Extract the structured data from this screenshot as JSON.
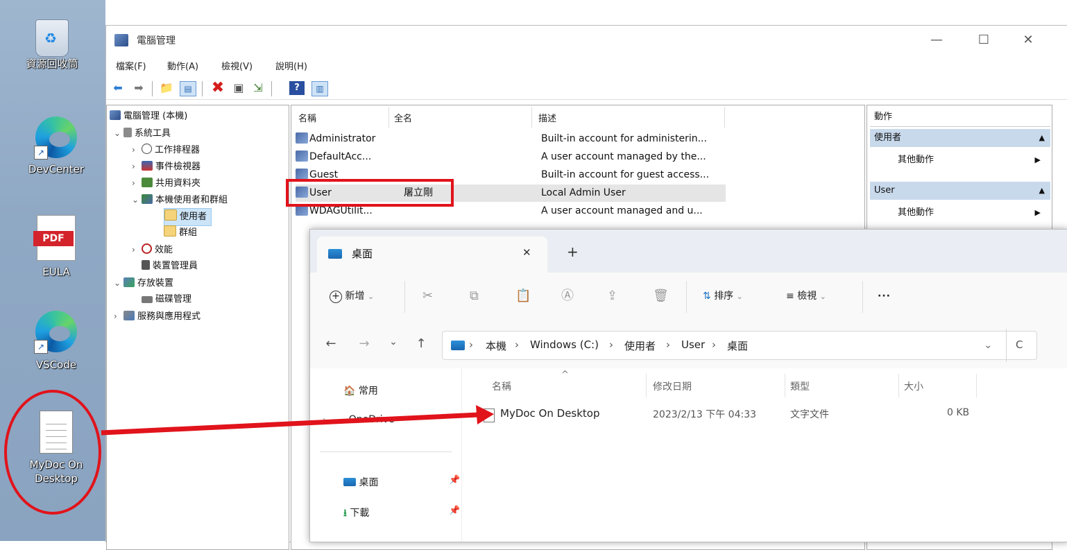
{
  "desktop": {
    "icons": [
      {
        "label": "資源回收筒",
        "icon": "recycle-bin-icon"
      },
      {
        "label": "DevCenter",
        "icon": "edge-icon"
      },
      {
        "label": "EULA",
        "icon": "pdf-icon",
        "badge": "PDF"
      },
      {
        "label": "VSCode",
        "icon": "edge-icon"
      },
      {
        "label": "MyDoc On Desktop",
        "icon": "text-document-icon"
      }
    ]
  },
  "cm": {
    "title": "電腦管理",
    "controls": {
      "minimize": "—",
      "maximize": "☐",
      "close": "✕"
    },
    "menu": [
      "檔案(F)",
      "動作(A)",
      "檢視(V)",
      "說明(H)"
    ],
    "tree": [
      {
        "label": "電腦管理 (本機)",
        "chevron": ""
      },
      {
        "label": "系統工具",
        "chevron": "⌄"
      },
      {
        "label": "工作排程器",
        "chevron": "›"
      },
      {
        "label": "事件檢視器",
        "chevron": "›"
      },
      {
        "label": "共用資料夾",
        "chevron": "›"
      },
      {
        "label": "本機使用者和群組",
        "chevron": "⌄"
      },
      {
        "label": "使用者",
        "chevron": ""
      },
      {
        "label": "群組",
        "chevron": ""
      },
      {
        "label": "效能",
        "chevron": "›"
      },
      {
        "label": "裝置管理員",
        "chevron": ""
      },
      {
        "label": "存放裝置",
        "chevron": "⌄"
      },
      {
        "label": "磁碟管理",
        "chevron": ""
      },
      {
        "label": "服務與應用程式",
        "chevron": "›"
      }
    ],
    "list": {
      "headers": {
        "name": "名稱",
        "fullname": "全名",
        "desc": "描述"
      },
      "rows": [
        {
          "name": "Administrator",
          "fullname": "",
          "desc": "Built-in account for administerin..."
        },
        {
          "name": "DefaultAcc...",
          "fullname": "",
          "desc": "A user account managed by the..."
        },
        {
          "name": "Guest",
          "fullname": "",
          "desc": "Built-in account for guest access..."
        },
        {
          "name": "User",
          "fullname": "屠立剛",
          "desc": "Local Admin User"
        },
        {
          "name": "WDAGUtilit...",
          "fullname": "",
          "desc": "A user account managed and u..."
        }
      ]
    },
    "actions": {
      "header": "動作",
      "sections": [
        {
          "title": "使用者",
          "item": "其他動作"
        },
        {
          "title": "User",
          "item": "其他動作"
        }
      ]
    }
  },
  "explorer": {
    "tab_title": "桌面",
    "tab_close": "✕",
    "new_tab": "+",
    "toolbar": {
      "new": "新增",
      "sort": "排序",
      "view": "檢視",
      "more": "···"
    },
    "nav": {
      "back": "←",
      "forward": "→",
      "recent": "⌄",
      "up": "↑",
      "refresh": "C",
      "dropdown": "⌄"
    },
    "breadcrumb": [
      "本機",
      "Windows (C:)",
      "使用者",
      "User",
      "桌面"
    ],
    "sidebar": {
      "home": "常用",
      "onedrive": "OneDrive",
      "desktop": "桌面",
      "downloads": "下載"
    },
    "columns": {
      "name": "名稱",
      "modified": "修改日期",
      "type": "類型",
      "size": "大小"
    },
    "files": [
      {
        "name": "MyDoc On Desktop",
        "modified": "2023/2/13 下午 04:33",
        "type": "文字文件",
        "size": "0 KB"
      }
    ]
  },
  "colors": {
    "highlight": "#e1131b",
    "selection": "#cce4f7",
    "accent": "#1a73c8"
  }
}
